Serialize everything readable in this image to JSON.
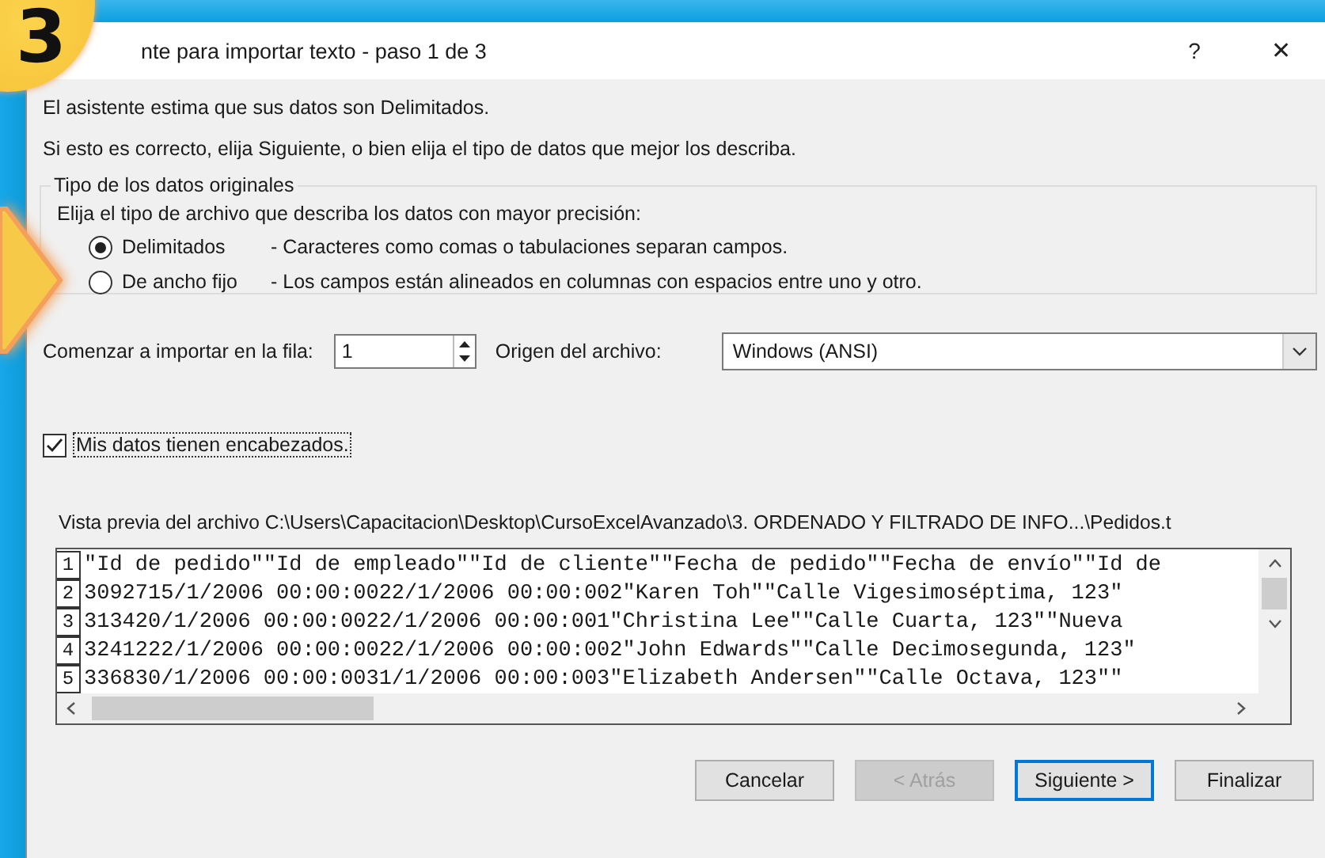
{
  "badge": "3",
  "window": {
    "title": "nte para importar texto - paso 1 de 3",
    "help": "?",
    "close": "✕"
  },
  "intro": [
    "El asistente estima que sus datos son Delimitados.",
    "Si esto es correcto, elija Siguiente, o bien elija el tipo de datos que mejor los describa."
  ],
  "group": {
    "legend": "Tipo de los datos originales",
    "prompt": "Elija el tipo de archivo que describa los datos con mayor precisión:",
    "options": [
      {
        "label": "Delimitados",
        "description": "- Caracteres como comas o tabulaciones separan campos.",
        "selected": true
      },
      {
        "label": "De ancho fijo",
        "description": "- Los campos están alineados en columnas con espacios entre uno y otro.",
        "selected": false
      }
    ]
  },
  "start_row": {
    "label": "Comenzar a importar en la fila:",
    "value": "1"
  },
  "origin": {
    "label": "Origen del archivo:",
    "value": "Windows (ANSI)"
  },
  "header_checkbox": {
    "label": "Mis datos tienen encabezados.",
    "checked": true
  },
  "preview": {
    "label": "Vista previa del archivo C:\\Users\\Capacitacion\\Desktop\\CursoExcelAvanzado\\3. ORDENADO Y FILTRADO DE INFO...\\Pedidos.t",
    "lines": [
      {
        "number": "1",
        "text": "\"Id de pedido\"\"Id de empleado\"\"Id de cliente\"\"Fecha de pedido\"\"Fecha de envío\"\"Id de"
      },
      {
        "number": "2",
        "text": "3092715/1/2006 00:00:0022/1/2006 00:00:002\"Karen Toh\"\"Calle Vigesimoséptima, 123\""
      },
      {
        "number": "3",
        "text": "313420/1/2006 00:00:0022/1/2006 00:00:001\"Christina Lee\"\"Calle Cuarta, 123\"\"Nueva"
      },
      {
        "number": "4",
        "text": "3241222/1/2006 00:00:0022/1/2006 00:00:002\"John Edwards\"\"Calle Decimosegunda, 123\""
      },
      {
        "number": "5",
        "text": "336830/1/2006 00:00:0031/1/2006 00:00:003\"Elizabeth Andersen\"\"Calle Octava, 123\"\""
      }
    ]
  },
  "buttons": [
    {
      "label": "Cancelar",
      "disabled": false,
      "default": false
    },
    {
      "label": "< Atrás",
      "disabled": true,
      "default": false
    },
    {
      "label": "Siguiente >",
      "disabled": false,
      "default": true
    },
    {
      "label": "Finalizar",
      "disabled": false,
      "default": false
    }
  ]
}
